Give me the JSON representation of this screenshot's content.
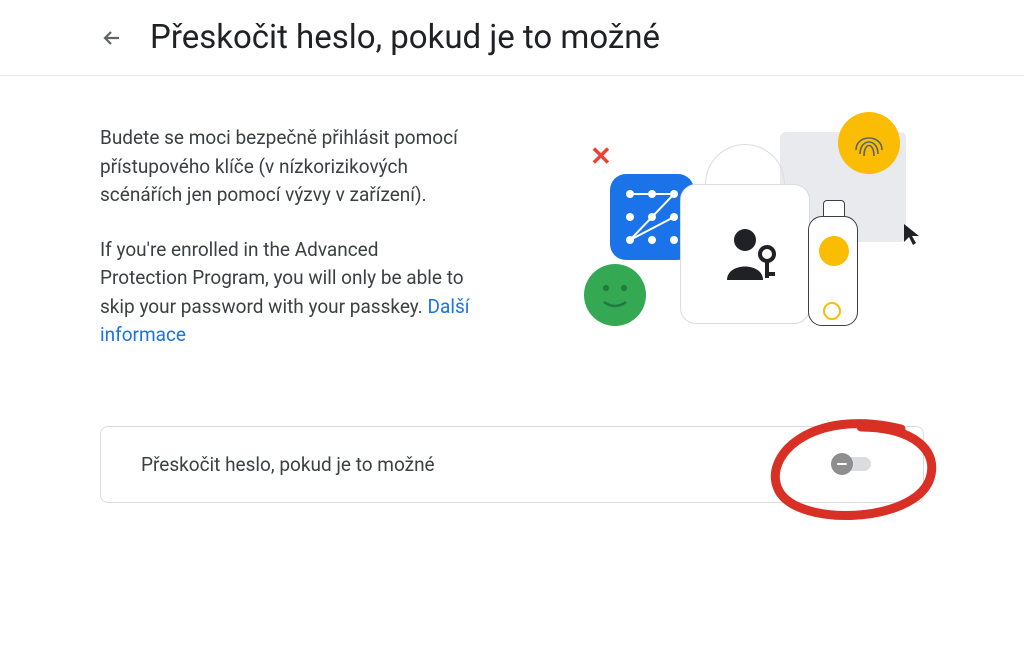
{
  "header": {
    "title": "Přeskočit heslo, pokud je to možné"
  },
  "description": {
    "paragraph1": "Budete se moci bezpečně přihlásit pomocí přístupového klíče (v nízkorizikových scénářích jen pomocí výzvy v zařízení).",
    "paragraph2_prefix": "If you're enrolled in the Advanced Protection Program, you will only be able to skip your password with your passkey. ",
    "learn_more": "Další informace"
  },
  "toggle": {
    "label": "Přeskočit heslo, pokud je to možné",
    "state": "off"
  }
}
